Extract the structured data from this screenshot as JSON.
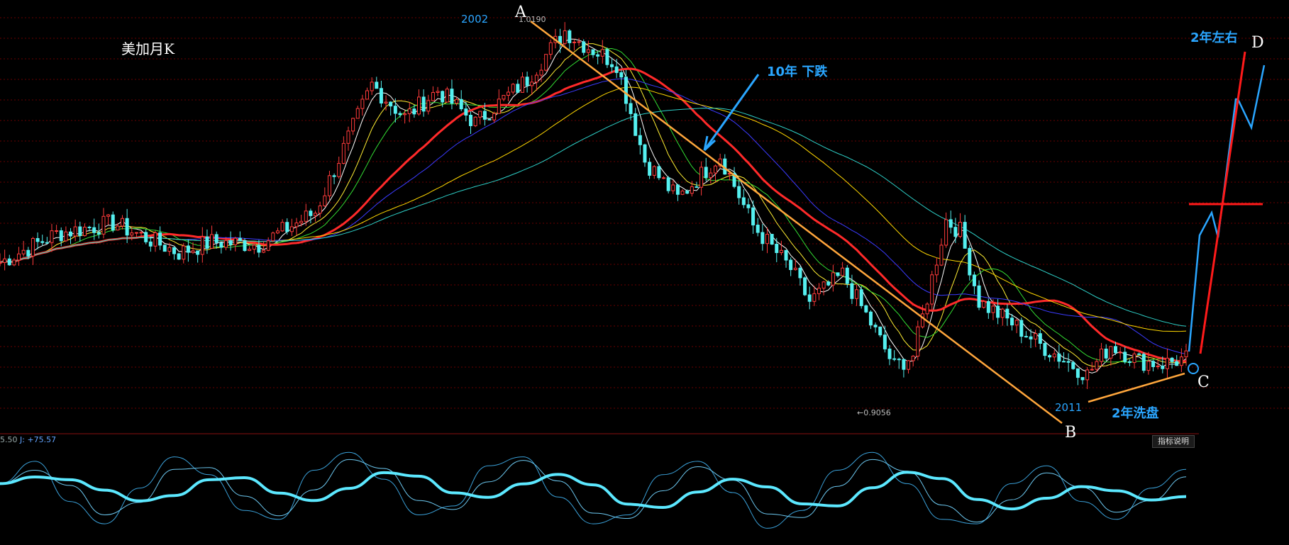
{
  "chart_data": {
    "type": "candlestick",
    "title": "美加月K",
    "annotations": {
      "point_a": "A",
      "point_b": "B",
      "point_c": "C",
      "point_d": "D",
      "year_2002": "2002",
      "year_2011": "2011",
      "high_value": "1.0190",
      "low_value": "←0.9056",
      "decline_note": "10年 下跌",
      "wash_note": "2年洗盘",
      "projection_note": "2年左右"
    },
    "indicator": {
      "readout_prefix": "5.50",
      "j_label": "J:",
      "j_value": "+75.57"
    },
    "price_path": [
      [
        "1992-01",
        1.172
      ],
      [
        "1993-01",
        1.225
      ],
      [
        "1994-01",
        1.245
      ],
      [
        "1995-03",
        1.19
      ],
      [
        "1995-10",
        1.21
      ],
      [
        "1996-08",
        1.205
      ],
      [
        "1997-08",
        1.265
      ],
      [
        "1998-08",
        1.5
      ],
      [
        "1999-03",
        1.44
      ],
      [
        "1999-10",
        1.49
      ],
      [
        "2000-06",
        1.43
      ],
      [
        "2001-05",
        1.51
      ],
      [
        "2002-01",
        1.6
      ],
      [
        "2002-04",
        1.58
      ],
      [
        "2002-12",
        1.54
      ],
      [
        "2003-06",
        1.36
      ],
      [
        "2004-01",
        1.29
      ],
      [
        "2004-10",
        1.37
      ],
      [
        "2005-05",
        1.24
      ],
      [
        "2006-01",
        1.16
      ],
      [
        "2006-05",
        1.1
      ],
      [
        "2006-12",
        1.15
      ],
      [
        "2007-06",
        1.06
      ],
      [
        "2007-11",
        0.98
      ],
      [
        "2008-03",
        1.0
      ],
      [
        "2008-10",
        1.25
      ],
      [
        "2009-01",
        1.23
      ],
      [
        "2009-05",
        1.1
      ],
      [
        "2009-12",
        1.06
      ],
      [
        "2010-06",
        1.02
      ],
      [
        "2011-04",
        0.965
      ],
      [
        "2011-09",
        1.02
      ],
      [
        "2012-03",
        0.99
      ],
      [
        "2012-08",
        0.985
      ],
      [
        "2013-01",
        0.995
      ]
    ],
    "kdj_j": [
      60,
      85,
      40,
      15,
      55,
      90,
      70,
      30,
      20,
      75,
      95,
      65,
      25,
      35,
      80,
      90,
      45,
      15,
      25,
      70,
      85,
      50,
      10,
      30,
      75,
      95,
      60,
      20,
      15,
      60,
      80,
      40,
      20,
      55,
      76
    ]
  },
  "ui": {
    "indicator_button": "指标说明"
  },
  "colors": {
    "background": "#000000",
    "grid": "#6a0000",
    "candle_up": "#ff3b3b",
    "candle_down": "#55f0f0",
    "ma_main": "#ff2a2a",
    "trend_line": "#ffa63c",
    "annotation_blue": "#2aa6ff",
    "kdj_main": "#5ce8ff"
  }
}
